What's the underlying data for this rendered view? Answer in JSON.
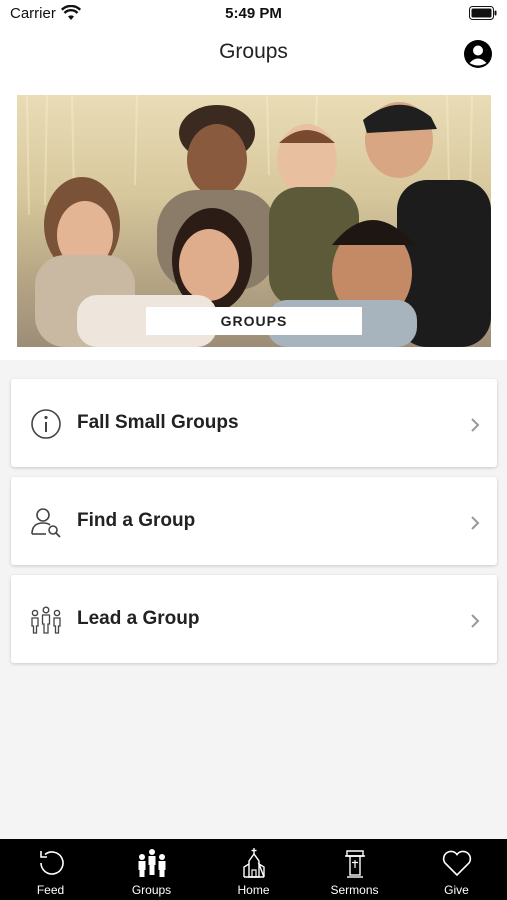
{
  "status_bar": {
    "carrier": "Carrier",
    "time": "5:49 PM"
  },
  "nav": {
    "title": "Groups",
    "profile_icon": "profile-icon"
  },
  "hero": {
    "label": "GROUPS"
  },
  "menu": {
    "items": [
      {
        "label": "Fall Small Groups",
        "icon": "info-icon"
      },
      {
        "label": "Find a Group",
        "icon": "person-search-icon"
      },
      {
        "label": "Lead a Group",
        "icon": "group-icon"
      }
    ]
  },
  "tab_bar": {
    "active": "Groups",
    "items": [
      {
        "label": "Feed",
        "icon": "feed-icon"
      },
      {
        "label": "Groups",
        "icon": "groups-icon"
      },
      {
        "label": "Home",
        "icon": "church-icon"
      },
      {
        "label": "Sermons",
        "icon": "pulpit-icon"
      },
      {
        "label": "Give",
        "icon": "heart-icon"
      }
    ]
  },
  "colors": {
    "background": "#f4f4f4",
    "card": "#ffffff",
    "tab_bar": "#000000",
    "text": "#222222"
  }
}
